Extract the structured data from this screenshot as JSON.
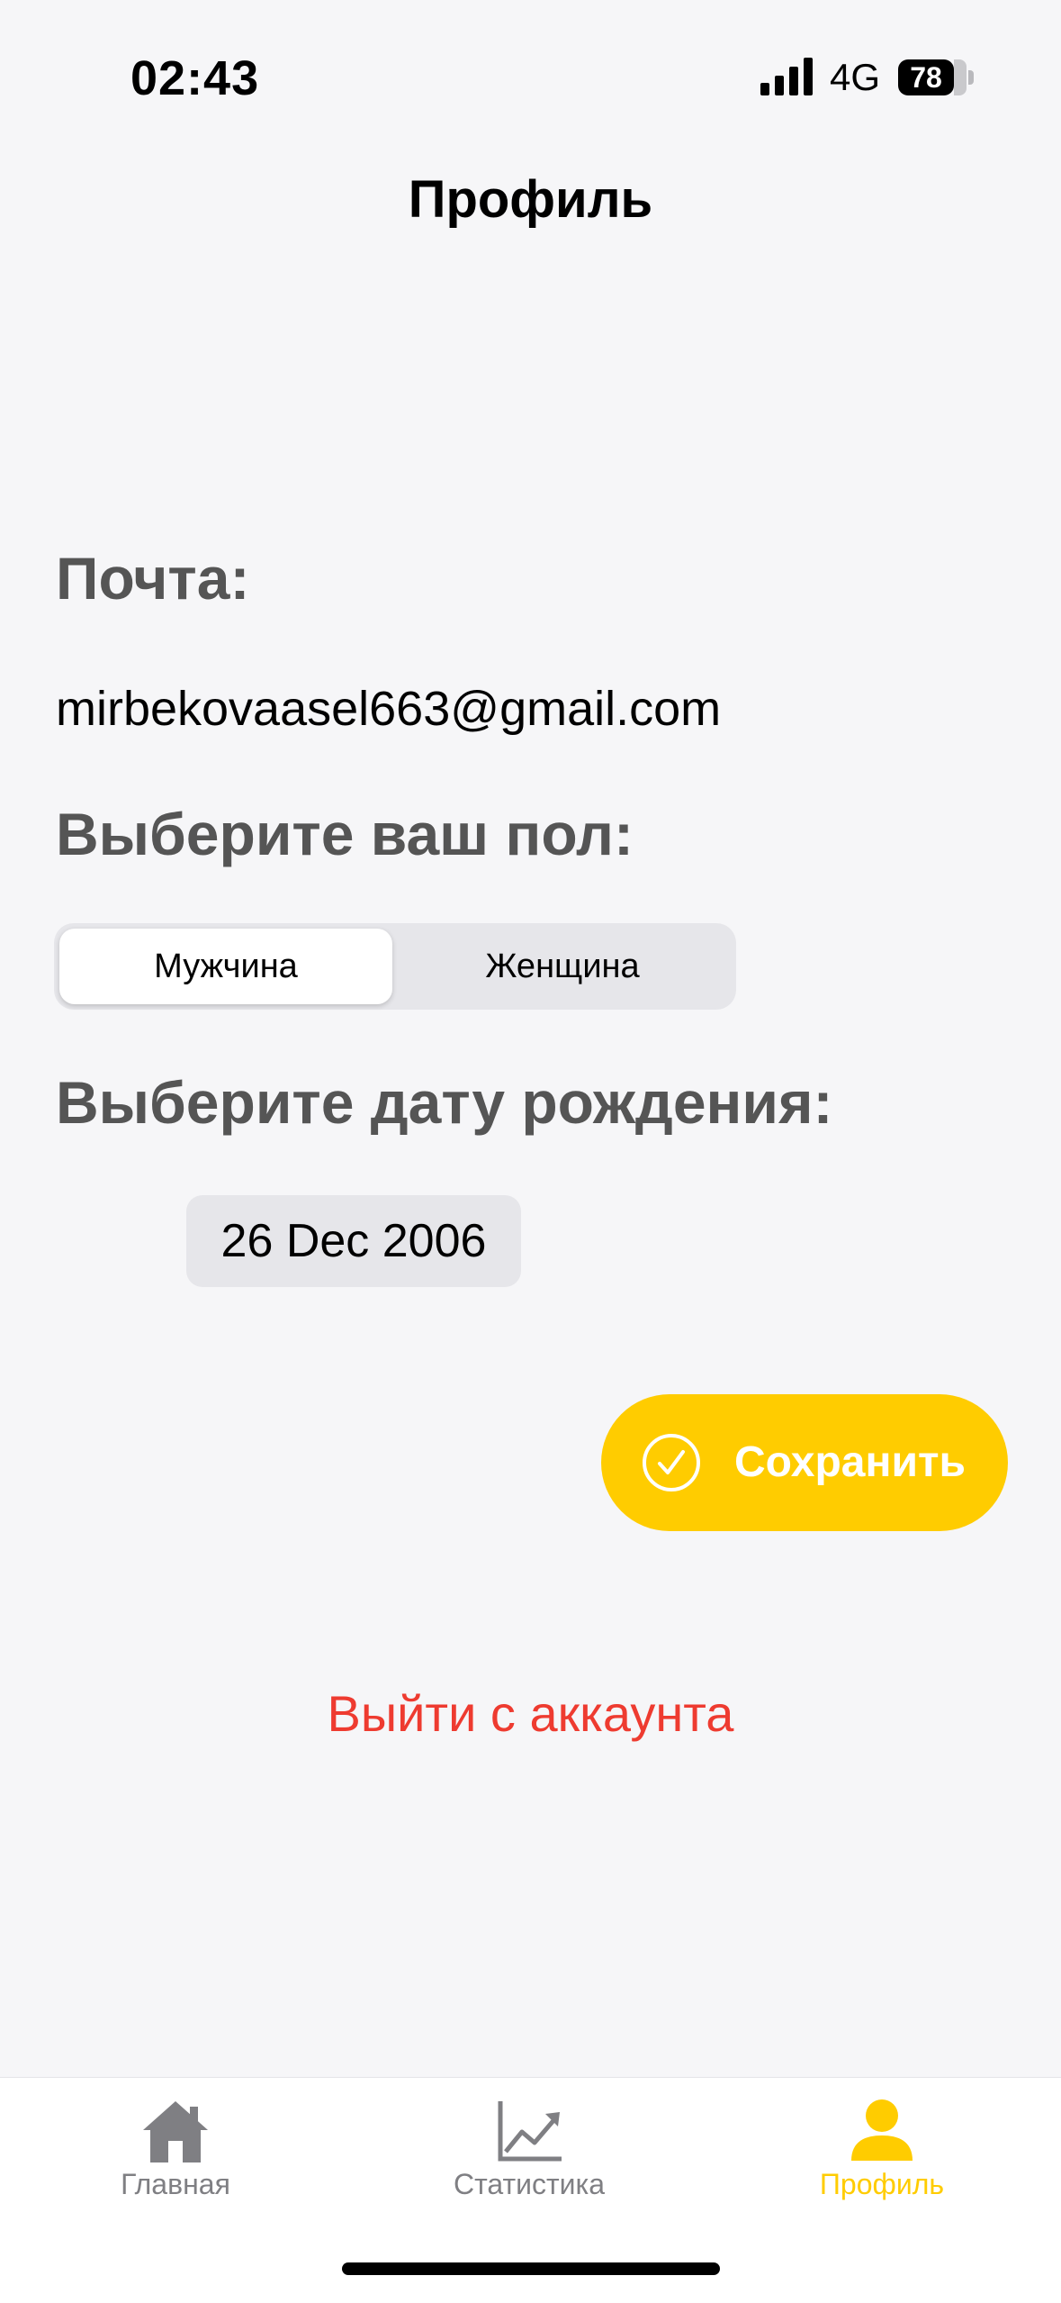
{
  "status_bar": {
    "time": "02:43",
    "network": "4G",
    "battery": "78"
  },
  "header": {
    "title": "Профиль"
  },
  "email": {
    "label": "Почта:",
    "value": "mirbekovaasel663@gmail.com"
  },
  "gender": {
    "label": "Выберите ваш пол:",
    "options": [
      "Мужчина",
      "Женщина"
    ],
    "selected": "Мужчина"
  },
  "birth_date": {
    "label": "Выберите дату рождения:",
    "value": "26 Dec 2006"
  },
  "save_button": {
    "label": "Сохранить",
    "icon": "check-circle-icon"
  },
  "logout": {
    "label": "Выйти с аккаунта"
  },
  "tab_bar": {
    "items": [
      {
        "label": "Главная",
        "icon": "home-icon",
        "active": false
      },
      {
        "label": "Статистика",
        "icon": "chart-icon",
        "active": false
      },
      {
        "label": "Профиль",
        "icon": "person-icon",
        "active": true
      }
    ]
  },
  "colors": {
    "accent": "#ffcc00",
    "danger": "#ee3b30",
    "muted": "#7f7f83",
    "background": "#f6f6f8"
  }
}
